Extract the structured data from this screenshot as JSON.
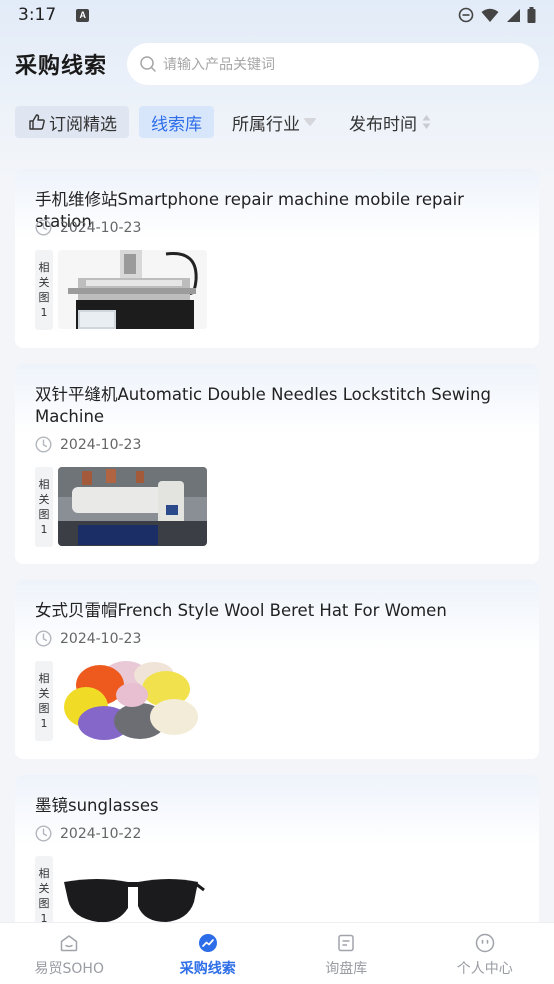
{
  "status": {
    "time": "3:17",
    "a_icon": "A"
  },
  "header": {
    "title": "采购线索",
    "search_placeholder": "请输入产品关键词"
  },
  "filters": {
    "subscribe": "订阅精选",
    "library": "线索库",
    "industry": "所属行业",
    "publish_time": "发布时间"
  },
  "cards": [
    {
      "title": "手机维修站Smartphone repair machine mobile repair station",
      "date": "2024-10-23",
      "tag_chars": [
        "相",
        "关",
        "图",
        "1"
      ]
    },
    {
      "title": "双针平缝机Automatic Double Needles Lockstitch Sewing Machine",
      "date": "2024-10-23",
      "tag_chars": [
        "相",
        "关",
        "图",
        "1"
      ]
    },
    {
      "title": "女式贝雷帽French Style Wool Beret Hat For Women",
      "date": "2024-10-23",
      "tag_chars": [
        "相",
        "关",
        "图",
        "1"
      ]
    },
    {
      "title": "墨镜sunglasses",
      "date": "2024-10-22",
      "tag_chars": [
        "相",
        "关",
        "图",
        "1"
      ]
    }
  ],
  "tabbar": {
    "home": "易贸SOHO",
    "leads": "采购线索",
    "inquiry": "询盘库",
    "profile": "个人中心"
  },
  "colors": {
    "accent": "#2d6ee8",
    "inactive": "#9a9ca3"
  }
}
